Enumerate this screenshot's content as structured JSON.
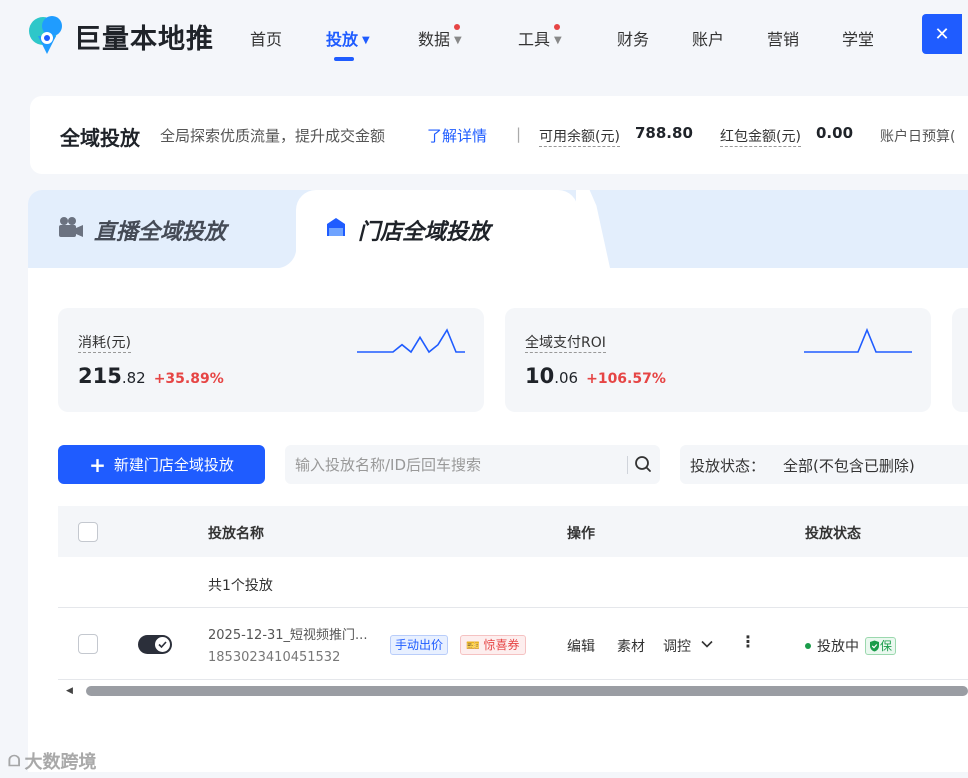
{
  "brand": {
    "name": "巨量本地推"
  },
  "nav": {
    "items": [
      {
        "label": "首页"
      },
      {
        "label": "投放"
      },
      {
        "label": "数据"
      },
      {
        "label": "工具"
      },
      {
        "label": "财务"
      },
      {
        "label": "账户"
      },
      {
        "label": "营销"
      },
      {
        "label": "学堂"
      }
    ]
  },
  "infobar": {
    "title": "全域投放",
    "desc": "全局探索优质流量，提升成交金额",
    "link": "了解详情",
    "sep": "|",
    "balance_label": "可用余额(元)",
    "balance_value": "788.80",
    "redpack_label": "红包金额(元)",
    "redpack_value": "0.00",
    "budget_label": "账户日预算("
  },
  "tabs": [
    {
      "label": "直播全域投放"
    },
    {
      "label": "门店全域投放"
    }
  ],
  "metrics": [
    {
      "label": "消耗(元)",
      "value_int": "215",
      "value_dec": ".82",
      "delta": "+35.89%",
      "trend": [
        3,
        3,
        3,
        3,
        3,
        2,
        3,
        1,
        3,
        2,
        0,
        3,
        3
      ]
    },
    {
      "label": "全域支付ROI",
      "value_int": "10",
      "value_dec": ".06",
      "delta": "+106.57%",
      "trend": [
        3,
        3,
        3,
        3,
        3,
        3,
        3,
        0,
        3,
        3,
        3,
        3,
        3
      ]
    }
  ],
  "toolbar": {
    "new_button": "新建门店全域投放",
    "search_placeholder": "输入投放名称/ID后回车搜索",
    "status_label": "投放状态：",
    "status_value": "全部(不包含已删除)"
  },
  "table": {
    "headers": {
      "name": "投放名称",
      "ops": "操作",
      "status": "投放状态"
    },
    "summary": "共1个投放",
    "rows": [
      {
        "name": "2025-12-31_短视频推门...",
        "id": "1853023410451532",
        "tag_bid": "手动出价",
        "tag_coupon": "惊喜券",
        "op_edit": "编辑",
        "op_material": "素材",
        "op_control": "调控",
        "status": "投放中",
        "badge": "保"
      }
    ]
  },
  "watermark": "大数跨境",
  "colors": {
    "primary": "#1f5cff",
    "danger": "#e64545",
    "success": "#1a9c4a"
  }
}
